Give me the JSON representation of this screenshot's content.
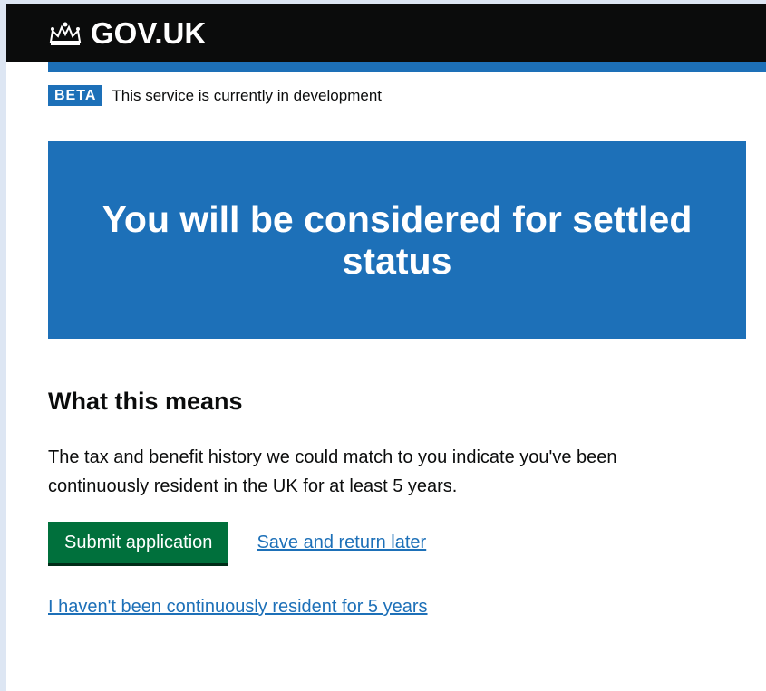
{
  "header": {
    "logo_text": "GOV.UK",
    "logo_icon": "crown-icon"
  },
  "phase_banner": {
    "tag": "BETA",
    "text": "This service is currently in development"
  },
  "panel": {
    "title": "You will be considered for settled status"
  },
  "content": {
    "heading": "What this means",
    "body": "The tax and benefit history we could match to you indicate you've been continuously resident in the UK for at least 5 years."
  },
  "actions": {
    "submit_label": "Submit application",
    "save_link": "Save and return later",
    "not_resident_link": "I haven't been continuously resident for 5 years"
  },
  "colors": {
    "header": "#0b0c0c",
    "brand_blue": "#1d70b8",
    "button_green": "#00703c",
    "background": "#dde6f3"
  }
}
